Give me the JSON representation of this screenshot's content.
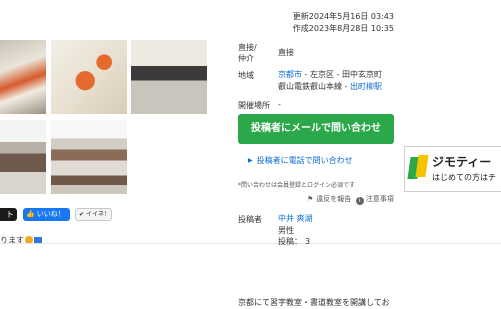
{
  "dates": {
    "updated": "更新2024年5月16日 03:43",
    "created": "作成2023年8月28日 10:35"
  },
  "details": {
    "direct_label": "直接/\n仲介",
    "direct_value": "直接",
    "area_label": "地域",
    "area_city": "京都市",
    "area_rest": " - 左京区 - 田中玄京町",
    "area_line": "叡山電鉄叡山本線 - ",
    "area_station": "出町柳駅",
    "venue_label": "開催場所",
    "venue_value": "-"
  },
  "actions": {
    "mail_button": "投稿者にメールで問い合わせ",
    "tel_link": "投稿者に電話で問い合わせ",
    "note": "*問い合わせは会員登録とログイン必須です",
    "report": "違反を報告",
    "caution": "注意事項"
  },
  "poster": {
    "label": "投稿者",
    "name": "中井 爽湖",
    "gender": "男性",
    "posts": "投稿：",
    "post_count": "3"
  },
  "social": {
    "x_label": "ト",
    "like_label": "いいね！",
    "iine_label": "イイネ！"
  },
  "description_fragment": "ります",
  "jimoty": {
    "title": "ジモティー",
    "subtitle": "はじめての方はチ"
  },
  "bottom_text": "京都にて習字教室・書道教室を開講してお"
}
